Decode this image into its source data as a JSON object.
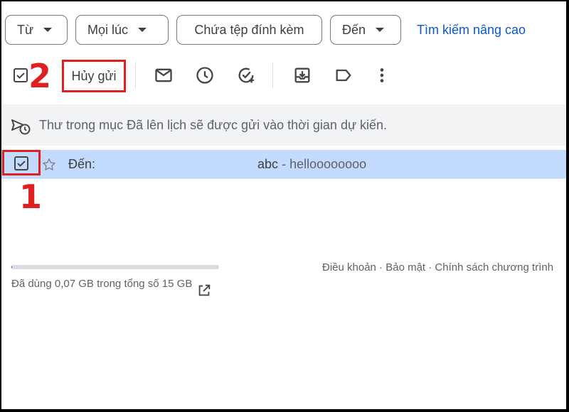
{
  "search_chips": {
    "from": "Từ",
    "time": "Mọi lúc",
    "has_attachment": "Chứa tệp đính kèm",
    "to": "Đến",
    "advanced_search": "Tìm kiếm nâng cao"
  },
  "toolbar": {
    "cancel_send": "Hủy gửi",
    "icons": [
      "checkbox-icon",
      "mail-icon",
      "clock-icon",
      "add-task-icon",
      "archive-icon",
      "label-icon",
      "more-vert-icon"
    ]
  },
  "annotations": {
    "step_1": "1",
    "step_2": "2",
    "highlight_color": "#e02020"
  },
  "banner": {
    "text": "Thư trong mục Đã lên lịch sẽ được gửi vào thời gian dự kiến."
  },
  "email_rows": [
    {
      "to_label": "Đến:",
      "subject": "abc",
      "separator": "-",
      "snippet": "helloooooooo",
      "selected": true
    }
  ],
  "footer": {
    "storage_text": "Đã dùng 0,07 GB trong tổng số 15 GB",
    "storage_used_fraction": 0.005,
    "links": "Điều khoản · Bảo mật · Chính sách chương trình"
  },
  "colors": {
    "accent": "#0b57d0",
    "selected_row": "#c2dbff",
    "banner_bg": "#f1f3f4"
  }
}
